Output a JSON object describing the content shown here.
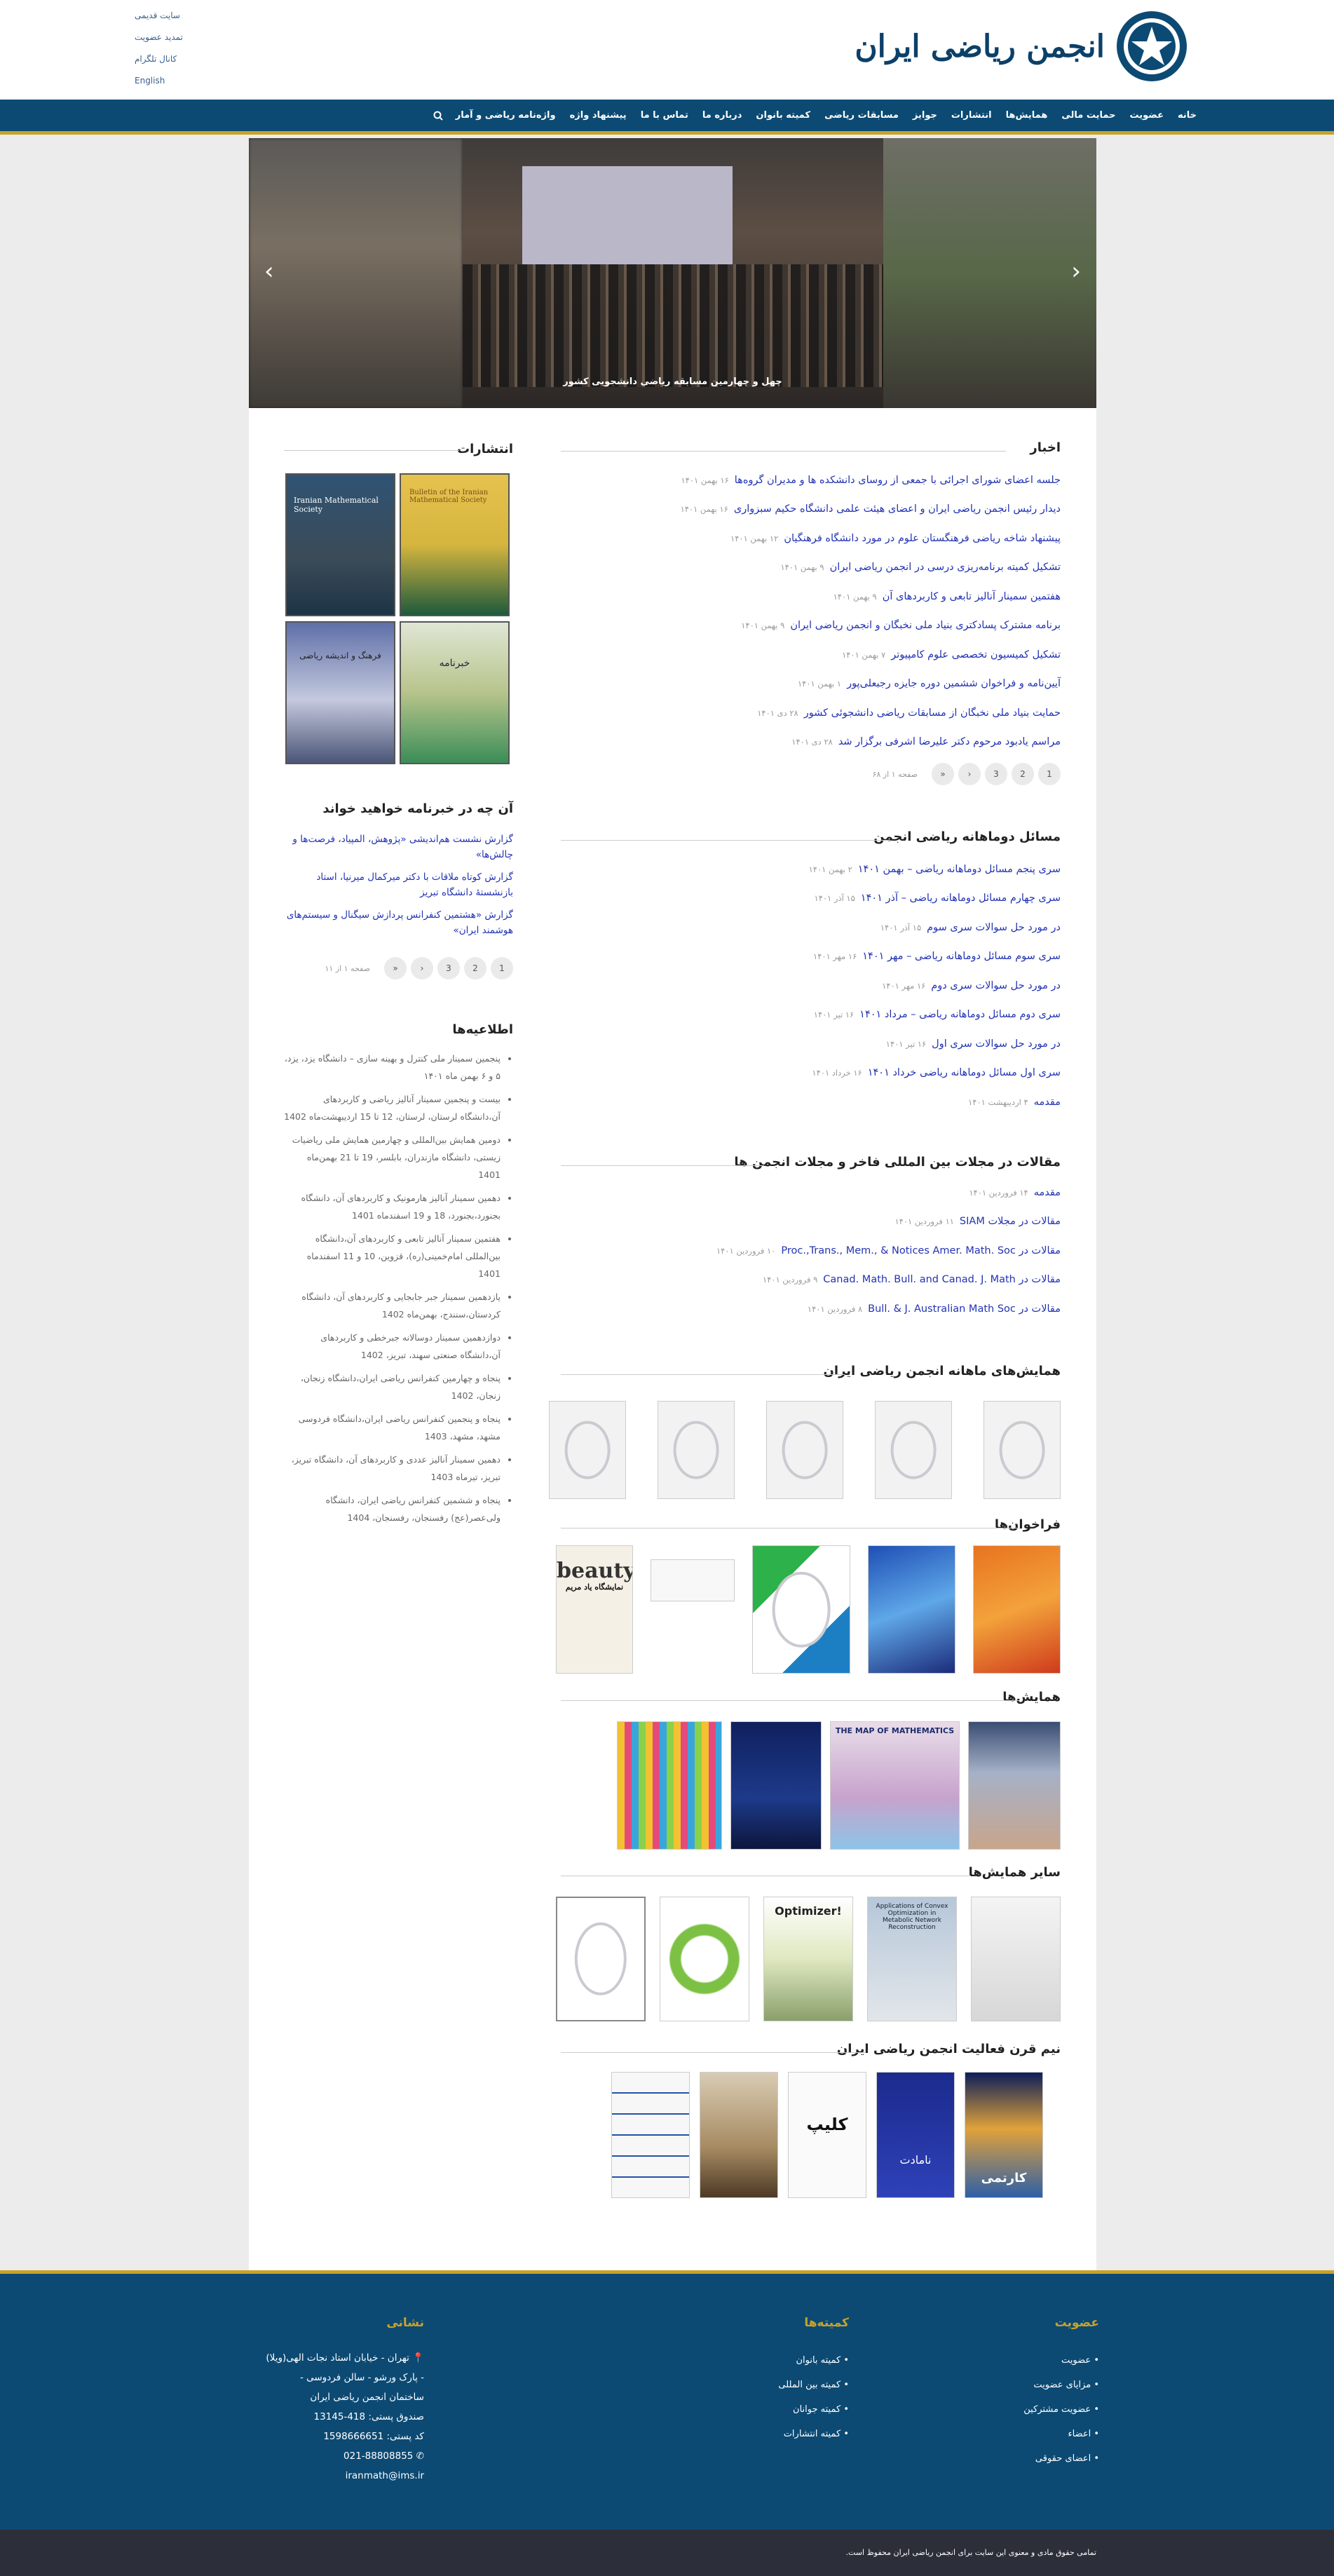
{
  "header": {
    "top_links": [
      "سایت قدیمی",
      "تمدید عضویت",
      "کانال تلگرام",
      "English"
    ],
    "logo_title": "انجمن ریاضی ایران"
  },
  "nav": {
    "items": [
      "خانه",
      "عضویت",
      "حمایت مالی",
      "همایش‌ها",
      "انتشارات",
      "جوایز",
      "مسابقات ریاضی",
      "کمیته بانوان",
      "درباره ما",
      "تماس با ما",
      "پیشنهاد واژه",
      "واژه‌نامه ریاضی و آمار"
    ],
    "search_icon": "search-icon"
  },
  "slider": {
    "caption": "چهل و چهارمین مسابقه ریاضی دانشجویی کشور"
  },
  "news": {
    "title": "اخبار",
    "items": [
      {
        "title": "جلسه اعضای شورای اجرائی با جمعی از روسای دانشکده ها و مدیران گروه‌ها",
        "date": "۱۶ بهمن ۱۴۰۱"
      },
      {
        "title": "دیدار رئیس انجمن ریاضی ایران و اعضای هیئت علمی دانشگاه حکیم سبزواری",
        "date": "۱۶ بهمن ۱۴۰۱"
      },
      {
        "title": "پیشنهاد شاخه ریاضی فرهنگستان علوم در مورد دانشگاه فرهنگیان",
        "date": "۱۲ بهمن ۱۴۰۱"
      },
      {
        "title": "تشکیل کمیته برنامه‌ریزی درسی در انجمن ریاضی ایران",
        "date": "۹ بهمن ۱۴۰۱"
      },
      {
        "title": "هفتمین سمینار آنالیز تابعی و کاربردهای آن",
        "date": "۹ بهمن ۱۴۰۱"
      },
      {
        "title": "برنامه مشترک پسادکتری بنیاد ملی نخبگان و انجمن ریاضی ایران",
        "date": "۹ بهمن ۱۴۰۱"
      },
      {
        "title": "تشکیل کمیسیون تخصصی علوم کامپیوتر",
        "date": "۷ بهمن ۱۴۰۱"
      },
      {
        "title": "آیین‌نامه و فراخوان ششمین دوره جایزه رجبعلی‌پور",
        "date": "۱ بهمن ۱۴۰۱"
      },
      {
        "title": "حمایت بنیاد ملی نخبگان از مسابقات ریاضی دانشجوئی کشور",
        "date": "۲۸ دی ۱۴۰۱"
      },
      {
        "title": "مراسم یادبود مرحوم دکتر علیرضا اشرفی برگزار شد",
        "date": "۲۸ دی ۱۴۰۱"
      }
    ],
    "pager": [
      "1",
      "2",
      "3",
      "›",
      "»"
    ],
    "pager_info": "صفحه ۱ از ۶۸"
  },
  "problems": {
    "title": "مسائل دوماهانه ریاضی انجمن",
    "items": [
      {
        "title": "سری پنجم مسائل دوماهانه ریاضی – بهمن ۱۴۰۱",
        "date": "۲ بهمن ۱۴۰۱"
      },
      {
        "title": "سری چهارم مسائل دوماهانه ریاضی – آذر ۱۴۰۱",
        "date": "۱۵ آذر ۱۴۰۱"
      },
      {
        "title": "در مورد حل سوالات سری سوم",
        "date": "۱۵ آذر ۱۴۰۱"
      },
      {
        "title": "سری سوم مسائل دوماهانه ریاضی – مهر ۱۴۰۱",
        "date": "۱۶ مهر ۱۴۰۱"
      },
      {
        "title": "در مورد حل سوالات سری دوم",
        "date": "۱۶ مهر ۱۴۰۱"
      },
      {
        "title": "سری دوم مسائل دوماهانه ریاضی – مرداد ۱۴۰۱",
        "date": "۱۶ تیر ۱۴۰۱"
      },
      {
        "title": "در مورد حل سوالات سری اول",
        "date": "۱۶ تیر ۱۴۰۱"
      },
      {
        "title": "سری اول مسائل دوماهانه ریاضی خرداد ۱۴۰۱",
        "date": "۱۶ خرداد ۱۴۰۱"
      },
      {
        "title": "مقدمه",
        "date": "۴ اردیبهشت ۱۴۰۱"
      }
    ]
  },
  "articles": {
    "title": "مقالات در مجلات بین المللی فاخر و مجلات انجمن ها",
    "items": [
      {
        "title": "مقدمه",
        "date": "۱۴ فروردین ۱۴۰۱"
      },
      {
        "title": "مقالات در مجلات SIAM",
        "date": "۱۱ فروردین ۱۴۰۱"
      },
      {
        "title": "مقالات در Proc.,Trans., Mem., & Notices Amer. Math. Soc",
        "date": "۱۰ فروردین ۱۴۰۱"
      },
      {
        "title": "مقالات در Canad. Math. Bull. and Canad. J. Math",
        "date": "۹ فروردین ۱۴۰۱"
      },
      {
        "title": "مقالات در Bull. & J. Australian Math Soc",
        "date": "۸ فروردین ۱۴۰۱"
      }
    ]
  },
  "gallery": {
    "monthly_title": "همایش‌های ماهانه انجمن ریاضی ایران",
    "calls_title": "فراخوان‌ها",
    "conferences_title": "همایش‌ها",
    "other_title": "سایر همایش‌ها",
    "half_century_title": "نیم قرن فعالیت انجمن ریاضی ایران",
    "call_poster_texts": [
      "beauty",
      "نمایشگاه یاد مریم",
      "Optimizer!",
      "THE MAP OF MATHEMATICS",
      "Applications of Convex Optimization in Metabolic Network Reconstruction",
      "کارتمی",
      "نامادت",
      "کلیپ"
    ]
  },
  "publications": {
    "title": "انتشارات",
    "covers": [
      "Bulletin of the Iranian Mathematical Society",
      "Iranian Mathematical Society",
      "فرهنگ و اندیشه ریاضی",
      "خبرنامه"
    ]
  },
  "newsletter": {
    "title": "آن چه در خبرنامه خواهید خواند",
    "items": [
      "گزارش نشست هم‌اندیشی «پژوهش، المپیاد، فرصت‌ها و چالش‌ها»",
      "گزارش کوتاه ملاقات با دکتر میرکمال میرنیا، استاد بازنشستۀ دانشگاه تبریز",
      "گزارش «هشتمین کنفرانس پردازش سیگنال و سیستم‌های هوشمند ایران»"
    ],
    "pager": [
      "1",
      "2",
      "3",
      "›",
      "»"
    ],
    "pager_info": "صفحه ۱ از ۱۱"
  },
  "notices": {
    "title": "اطلاعیه‌ها",
    "items": [
      "پنجمین سمینار ملی کنترل و بهینه سازی – دانشگاه یزد، یزد، ۵ و ۶ بهمن ماه ۱۴۰۱",
      "بیست و پنجمین سمینار آنالیز ریاضی و کاربردهای آن،دانشگاه لرستان، لرستان، 12 تا 15 اردیبهشت‌ماه 1402",
      "دومین همایش بین‌المللی و چهارمین همایش ملی ریاضیات زیستی، دانشگاه مازندران، بابلسر، 19 تا 21 بهمن‌ماه 1401",
      "دهمین سمینار آنالیز هارمونیک و کاربردهای آن، دانشگاه بجنورد،بجنورد، 18 و 19 اسفندماه 1401",
      "هفتمین سمینار آنالیز تابعی و کاربردهای آن،دانشگاه بین‌المللی امام‌خمینی(ره)، قزوین، 10 و 11 اسفندماه 1401",
      "یازدهمین سمینار جبر جابجایی و کاربردهای آن، دانشگاه کردستان،سنندج، بهمن‌ماه 1402",
      "دوازدهمین سمینار دوسالانه جبرخطی و کاربردهای آن،دانشگاه صنعتی سهند، تبریز، 1402",
      "پنجاه و چهارمین کنفرانس ریاضی ایران،دانشگاه زنجان، زنجان، 1402",
      "پنجاه و پنجمین کنفرانس ریاضی ایران،دانشگاه فردوسی مشهد، مشهد، 1403",
      "دهمین سمینار آنالیز عددی و کاربردهای آن، دانشگاه تبریز، تبریز، تیرماه 1403",
      "پنجاه و ششمین کنفرانس ریاضی ایران، دانشگاه ولی‌عصر(عج) رفسنجان، رفسنجان، 1404"
    ]
  },
  "footer": {
    "membership": {
      "title": "عضویت",
      "items": [
        "عضویت",
        "مزایای عضویت",
        "عضویت مشترکین",
        "اعضاء",
        "اعضای حقوقی"
      ]
    },
    "committees": {
      "title": "کمیته‌ها",
      "items": [
        "کمیته بانوان",
        "کمیته بین المللی",
        "کمیته جوانان",
        "کمیته انتشارات"
      ]
    },
    "address": {
      "title": "نشانی",
      "lines": [
        "تهران - خیابان استاد نجات الهی(ویلا)",
        "- پارک ورشو - سالن فردوسی -",
        "ساختمان انجمن ریاضی ایران",
        "صندوق پستی: 418-13145",
        "کد پستی: 1598666651",
        "021-88808855",
        "iranmath@ims.ir"
      ]
    },
    "copyright": "تمامی حقوق مادی و معنوی این سایت برای انجمن ریاضی ایران محفوظ است."
  },
  "colors": {
    "brand": "#0c4a73",
    "accent": "#c9a227",
    "link": "#2233b3"
  }
}
